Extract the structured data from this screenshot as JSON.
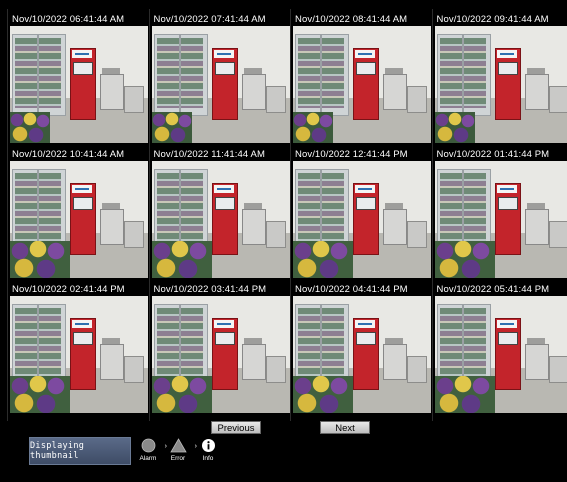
{
  "thumbnails": [
    {
      "time": "Nov/10/2022 06:41:44 AM",
      "selected": true
    },
    {
      "time": "Nov/10/2022 07:41:44 AM",
      "selected": false
    },
    {
      "time": "Nov/10/2022 08:41:44 AM",
      "selected": false
    },
    {
      "time": "Nov/10/2022 09:41:44 AM",
      "selected": false
    },
    {
      "time": "Nov/10/2022 10:41:44 AM",
      "selected": false
    },
    {
      "time": "Nov/10/2022 11:41:44 AM",
      "selected": false
    },
    {
      "time": "Nov/10/2022 12:41:44 PM",
      "selected": false
    },
    {
      "time": "Nov/10/2022 01:41:44 PM",
      "selected": false
    },
    {
      "time": "Nov/10/2022 02:41:44 PM",
      "selected": false
    },
    {
      "time": "Nov/10/2022 03:41:44 PM",
      "selected": false
    },
    {
      "time": "Nov/10/2022 04:41:44 PM",
      "selected": false
    },
    {
      "time": "Nov/10/2022 05:41:44 PM",
      "selected": false
    }
  ],
  "nav": {
    "previous_label": "Previous",
    "next_label": "Next"
  },
  "status": {
    "display_label": "Displaying thumbnail",
    "alarm_label": "Alarm",
    "error_label": "Error",
    "info_label": "Info"
  },
  "colors": {
    "selected_border": "#e07a1e",
    "atm_red": "#c3242b",
    "status_button": "#4a5875"
  },
  "icons": {
    "alarm": "alarm-circle-icon",
    "error": "error-triangle-icon",
    "info": "info-circle-icon",
    "chevron": "chevron-right-icon"
  }
}
